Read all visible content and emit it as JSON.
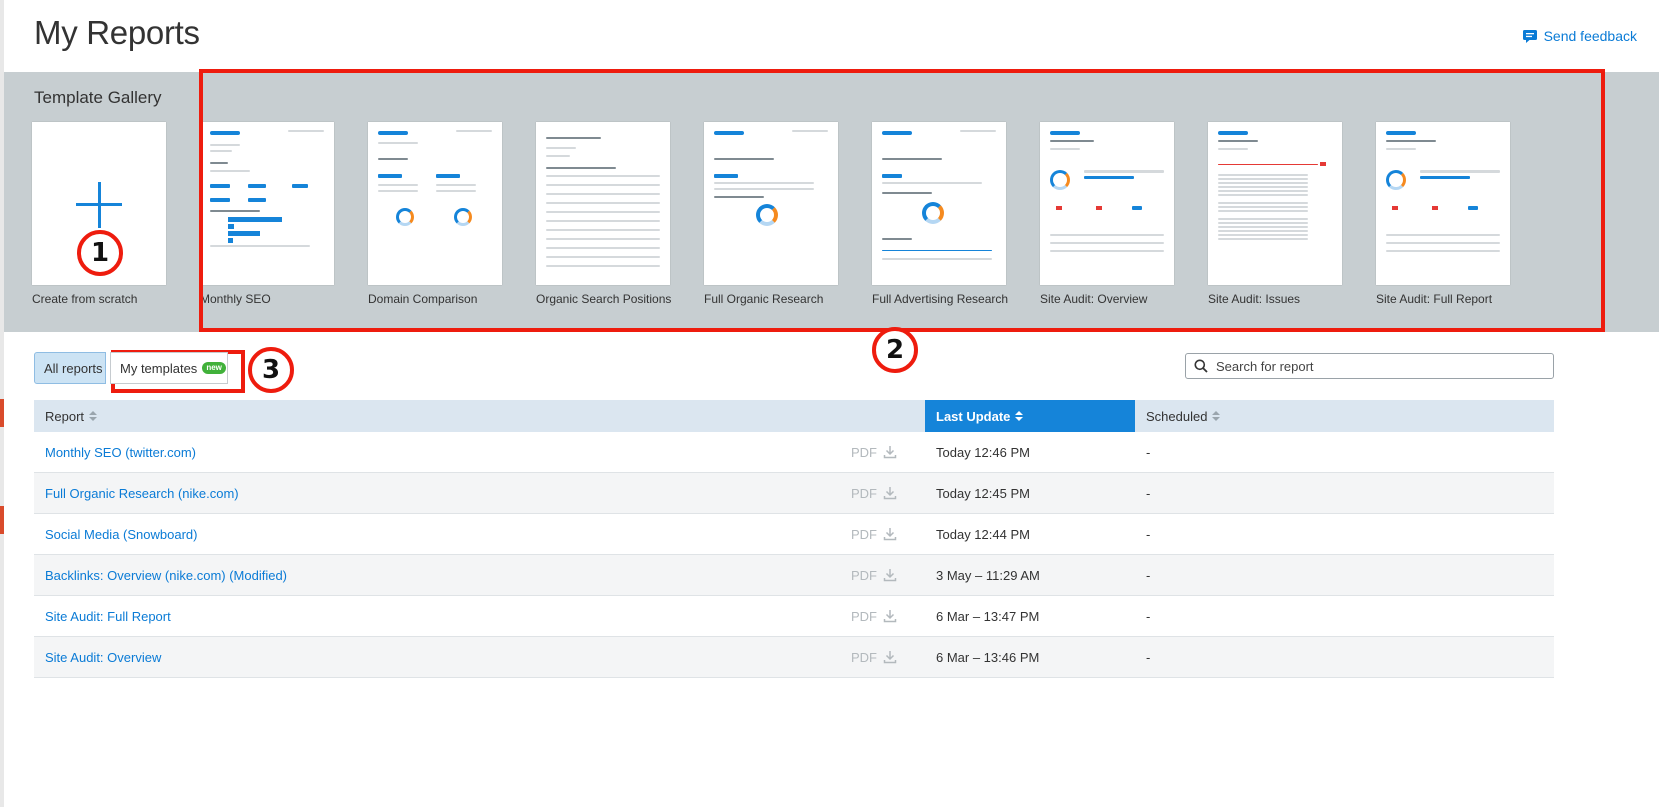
{
  "header": {
    "title": "My Reports",
    "feedback_label": "Send feedback"
  },
  "gallery": {
    "title": "Template Gallery",
    "create_label": "Create from scratch",
    "templates": [
      {
        "label": "Monthly SEO"
      },
      {
        "label": "Domain Comparison"
      },
      {
        "label": "Organic Search Positions"
      },
      {
        "label": "Full Organic Research"
      },
      {
        "label": "Full Advertising Research"
      },
      {
        "label": "Site Audit: Overview"
      },
      {
        "label": "Site Audit: Issues"
      },
      {
        "label": "Site Audit: Full Report"
      }
    ]
  },
  "callouts": [
    "1",
    "2",
    "3"
  ],
  "tabs": {
    "all_reports": "All reports",
    "my_templates": "My templates",
    "new_badge": "new"
  },
  "search": {
    "placeholder": "Search for report",
    "value": ""
  },
  "table": {
    "columns": {
      "report": "Report",
      "last_update": "Last Update",
      "scheduled": "Scheduled"
    },
    "pdf_label": "PDF",
    "rows": [
      {
        "name": "Monthly SEO (twitter.com)",
        "updated": "Today 12:46 PM",
        "scheduled": "-"
      },
      {
        "name": "Full Organic Research (nike.com)",
        "updated": "Today 12:45 PM",
        "scheduled": "-"
      },
      {
        "name": "Social Media (Snowboard)",
        "updated": "Today 12:44 PM",
        "scheduled": "-"
      },
      {
        "name": "Backlinks: Overview (nike.com) (Modified)",
        "updated": "3 May – 11:29 AM",
        "scheduled": "-"
      },
      {
        "name": "Site Audit: Full Report",
        "updated": "6 Mar – 13:47 PM",
        "scheduled": "-"
      },
      {
        "name": "Site Audit: Overview",
        "updated": "6 Mar – 13:46 PM",
        "scheduled": "-"
      }
    ]
  },
  "colors": {
    "accent": "#1584d9",
    "link": "#0a7bd6",
    "callout_red": "#ee1c0e",
    "gallery_bg": "#c7ced1",
    "new_badge": "#41b13a"
  }
}
